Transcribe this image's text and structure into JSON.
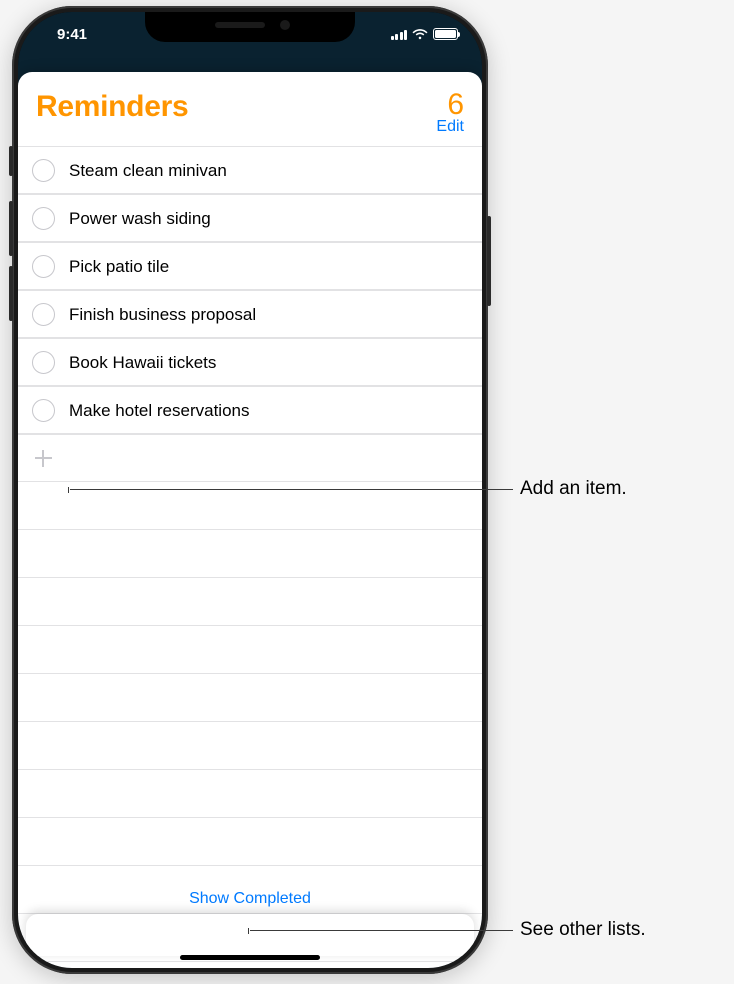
{
  "statusbar": {
    "time": "9:41"
  },
  "header": {
    "title": "Reminders",
    "count": "6",
    "edit": "Edit"
  },
  "reminders": [
    {
      "label": "Steam clean minivan"
    },
    {
      "label": "Power wash siding"
    },
    {
      "label": "Pick patio tile"
    },
    {
      "label": "Finish business proposal"
    },
    {
      "label": "Book Hawaii tickets"
    },
    {
      "label": "Make hotel reservations"
    }
  ],
  "footer": {
    "show_completed": "Show Completed"
  },
  "callouts": {
    "add_item": "Add an item.",
    "see_other": "See other lists."
  }
}
